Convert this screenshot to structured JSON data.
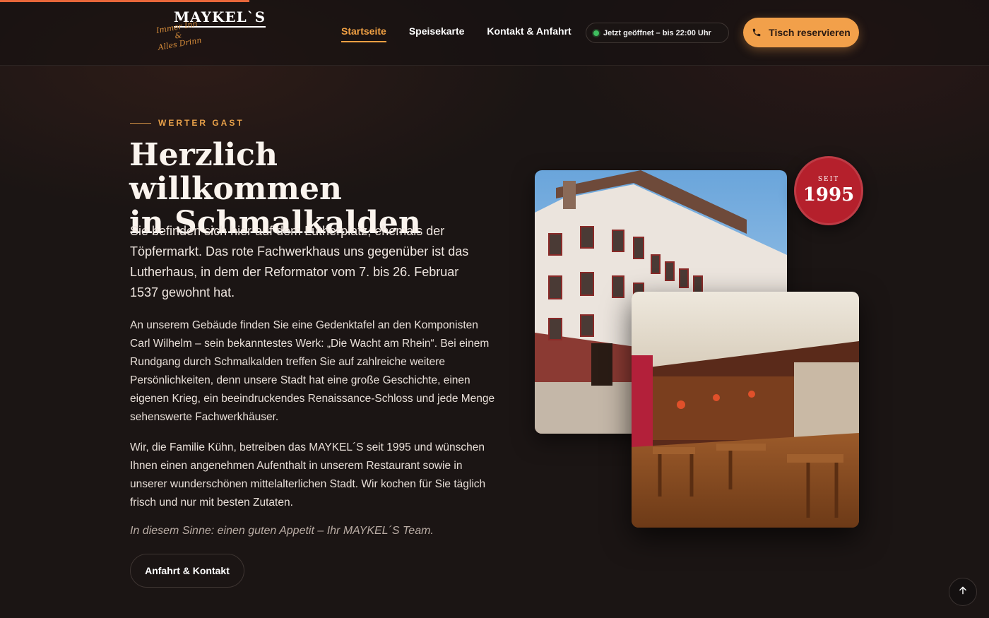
{
  "brand": {
    "name": "MAYKEL`S",
    "tagline_line1": "Immer Inn",
    "tagline_amp": "&",
    "tagline_line2": "Alles Drinn"
  },
  "nav": {
    "items": [
      {
        "label": "Startseite",
        "active": true
      },
      {
        "label": "Speisekarte",
        "active": false
      },
      {
        "label": "Kontakt & Anfahrt",
        "active": false
      }
    ]
  },
  "status": {
    "label": "Jetzt geöffnet – bis 22:00 Uhr",
    "color": "#3fbf5f"
  },
  "reserve_button": {
    "label": "Tisch reservieren",
    "icon": "phone-icon"
  },
  "hero": {
    "eyebrow": "WERTER GAST",
    "headline_line1": "Herzlich willkommen",
    "headline_line2": "in Schmalkalden",
    "lead": "Sie befinden sich hier auf dem Lutherplatz, ehemals der Töpfermarkt. Das rote Fachwerkhaus uns gegenüber ist das Lutherhaus, in dem der Reformator vom 7. bis 26. Februar 1537 gewohnt hat.",
    "paragraph1": "An unserem Gebäude finden Sie eine Gedenktafel an den Komponisten Carl Wilhelm – sein bekanntestes Werk: „Die Wacht am Rhein“. Bei einem Rundgang durch Schmalkalden treffen Sie auf zahlreiche weitere Persönlichkeiten, denn unsere Stadt hat eine große Geschichte, einen eigenen Krieg, ein beeindruckendes Renaissance-Schloss und jede Menge sehenswerte Fachwerkhäuser.",
    "paragraph2": "Wir, die Familie Kühn, betreiben das MAYKEL´S seit 1995 und wünschen Ihnen einen angenehmen Aufenthalt in unserem Restaurant sowie in unserer wunderschönen mittelalterlichen Stadt. Wir kochen für Sie täglich frisch und nur mit besten Zutaten.",
    "signoff": "In diesem Sinne: einen guten Appetit – Ihr MAYKEL´S Team.",
    "cta_label": "Anfahrt & Kontakt"
  },
  "badge": {
    "small": "SEIT",
    "year": "1995"
  },
  "colors": {
    "accent": "#f2a04a",
    "badge": "#b5202c",
    "background": "#1b1514"
  },
  "scroll_top": {
    "icon": "arrow-up-icon"
  }
}
